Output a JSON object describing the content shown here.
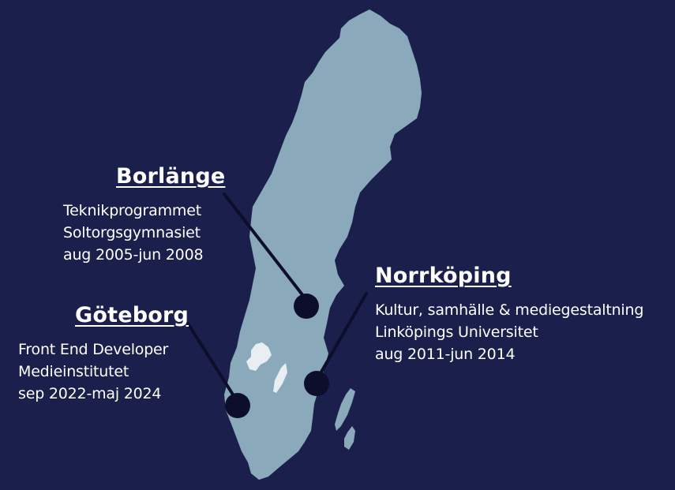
{
  "colors": {
    "background": "#1b1f4b",
    "land": "#8aaabb",
    "lake": "#e8eef2",
    "marker": "#0d0e2b",
    "text": "#ffffff"
  },
  "locations": [
    {
      "city": "Borlänge",
      "lines": [
        "Teknikprogrammet",
        "Soltorgsgymnasiet",
        "aug 2005-jun 2008"
      ]
    },
    {
      "city": "Göteborg",
      "lines": [
        "Front End Developer",
        "Medieinstitutet",
        "sep 2022-maj 2024"
      ]
    },
    {
      "city": "Norrköping",
      "lines": [
        "Kultur, samhälle & mediegestaltning",
        "Linköpings Universitet",
        "aug 2011-jun 2014"
      ]
    }
  ]
}
